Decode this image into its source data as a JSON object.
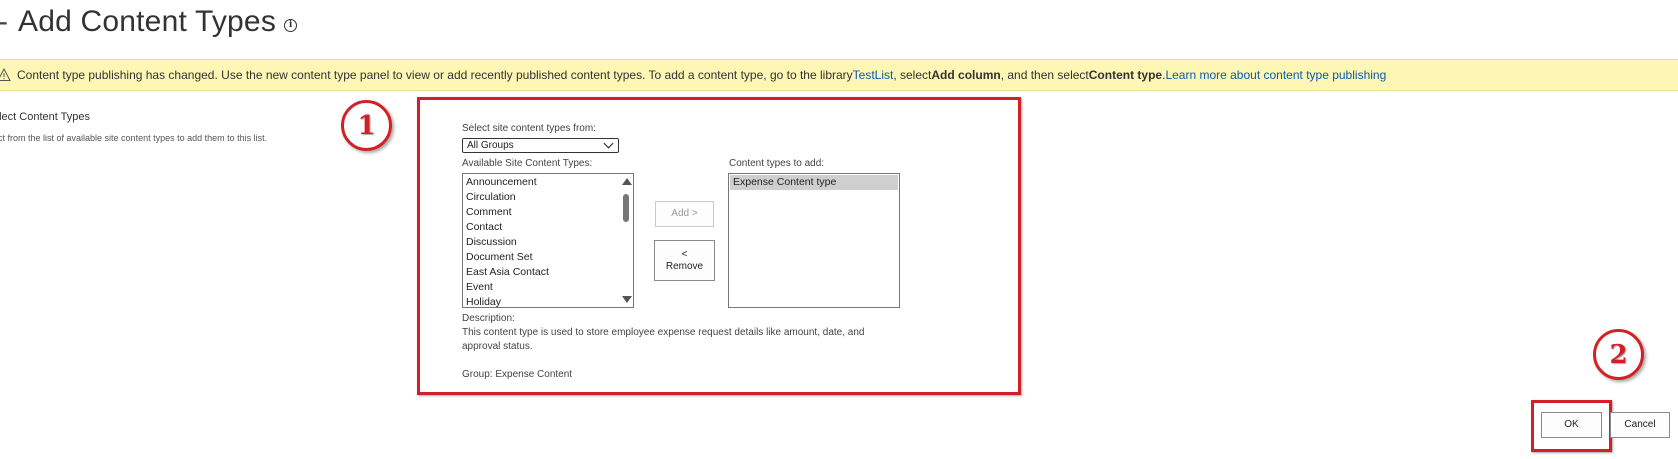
{
  "header": {
    "prefix": "-",
    "title": "Add Content Types",
    "info_icon": "info-icon"
  },
  "notice": {
    "icon": "warning-icon",
    "text_before": "Content type publishing has changed. Use the new content type panel to view or add recently published content types. To add a content type, go to the library ",
    "library_link": "TestList",
    "text_mid1": ", select ",
    "bold1": "Add column",
    "text_mid2": ", and then select ",
    "bold2": "Content type",
    "text_mid3": ". ",
    "learn_more": "Learn more about content type publishing"
  },
  "section": {
    "title": "elect Content Types",
    "description": "ect from the list of available site content types to add them to this list."
  },
  "form": {
    "select_from_label": "Select site content types from:",
    "group_selected": "All Groups",
    "available_label": "Available Site Content Types:",
    "available_items": [
      "Announcement",
      "Circulation",
      "Comment",
      "Contact",
      "Discussion",
      "Document Set",
      "East Asia Contact",
      "Event",
      "Holiday"
    ],
    "add_label": "Content types to add:",
    "add_items": [
      "Expense Content type"
    ],
    "add_button": "Add >",
    "remove_button_line1": "<",
    "remove_button_line2": "Remove",
    "description_label": "Description:",
    "description_text_1": "This content type is used to store employee expense request details like amount, date, and",
    "description_text_2": "approval status.",
    "group_text": "Group: Expense Content"
  },
  "annotations": {
    "badge_1": "1",
    "badge_2": "2",
    "accent_color": "#d32027"
  },
  "actions": {
    "ok": "OK",
    "cancel": "Cancel"
  },
  "colors": {
    "notice_bg": "#fdf6b4",
    "link": "#0b5cad"
  }
}
